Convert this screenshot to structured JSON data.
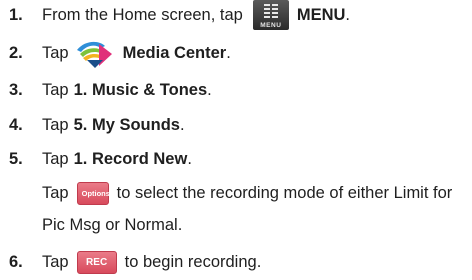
{
  "steps": [
    {
      "num": "1.",
      "pre": "From the Home screen, tap",
      "icon_caption": "MENU",
      "bold": "MENU",
      "post": "."
    },
    {
      "num": "2.",
      "pre": "Tap",
      "bold": "Media Center",
      "post": "."
    },
    {
      "num": "3.",
      "pre": "Tap",
      "bold": "1. Music & Tones",
      "post": "."
    },
    {
      "num": "4.",
      "pre": "Tap",
      "bold": "5. My Sounds",
      "post": "."
    },
    {
      "num": "5.",
      "pre": "Tap",
      "bold": "1. Record New",
      "post": "."
    },
    {
      "pre": "Tap",
      "key_label": "Options",
      "post_line1": "to select the recording mode of either Limit for",
      "post_line2": "Pic Msg or Normal."
    },
    {
      "num": "6.",
      "pre": "Tap",
      "key_label": "REC",
      "post": "to begin recording."
    }
  ],
  "icons": {
    "menu": "menu-grid-icon",
    "media": "media-center-arrow-icon",
    "key_color": "#d84a5c"
  }
}
